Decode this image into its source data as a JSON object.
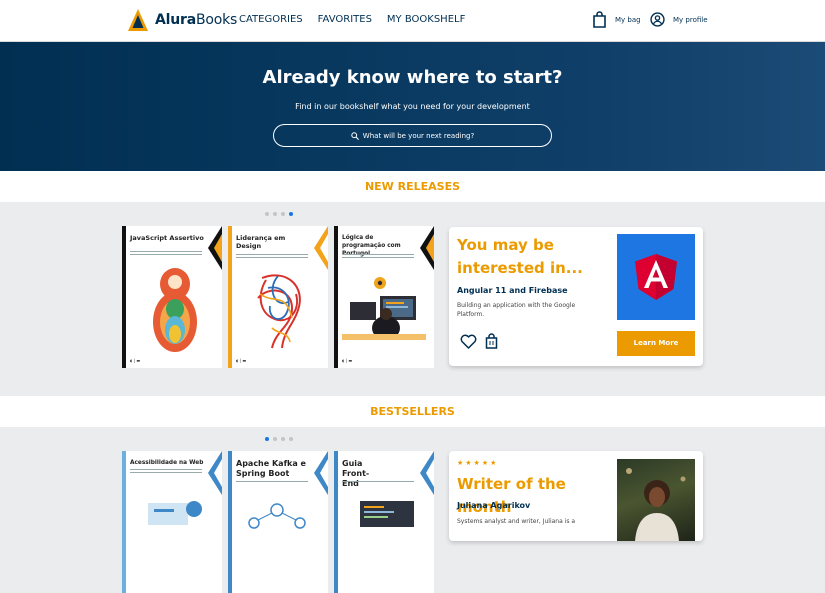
{
  "header": {
    "brand_bold": "Alura",
    "brand_rest": "Books",
    "nav": [
      "CATEGORIES",
      "FAVORITES",
      "MY BOOKSHELF"
    ],
    "bag_label": "My bag",
    "profile_label": "My profile"
  },
  "hero": {
    "title": "Already know where to start?",
    "subtitle": "Find in our bookshelf what you need for your development",
    "search_placeholder": "What will be your next reading?"
  },
  "new_releases": {
    "heading": "NEW RELEASES",
    "carousel_active_dot": 4,
    "books": [
      {
        "title": "JavaScript Assertivo",
        "accent": "#f2a31b"
      },
      {
        "title": "Liderança em Design",
        "accent": "#f2a31b"
      },
      {
        "title": "Lógica de programação com Portugol",
        "accent": "#f2a31b"
      }
    ],
    "card": {
      "heading": "You may be interested in...",
      "book_name": "Angular 11 and Firebase",
      "description": "Building an application with the Google Platform.",
      "button": "Learn More",
      "icons": [
        "heart-icon",
        "bag-icon"
      ]
    }
  },
  "bestsellers": {
    "heading": "BESTSELLERS",
    "carousel_active_dot": 1,
    "books": [
      {
        "title": "Acessibilidade na Web",
        "accent": "#3f88c8"
      },
      {
        "title": "Apache Kafka e Spring Boot",
        "accent": "#3f88c8"
      },
      {
        "title": "Guia Front-End",
        "accent": "#3f88c8"
      }
    ],
    "card": {
      "rating": "★★★★★",
      "heading": "Writer of the month",
      "name": "Juliana Agarikov",
      "description": "Systems analyst and writer, Juliana is a"
    }
  },
  "colors": {
    "navy": "#002f52",
    "orange": "#eb9b00",
    "angular_blue": "#1d76e2",
    "angular_red": "#dd0031"
  }
}
